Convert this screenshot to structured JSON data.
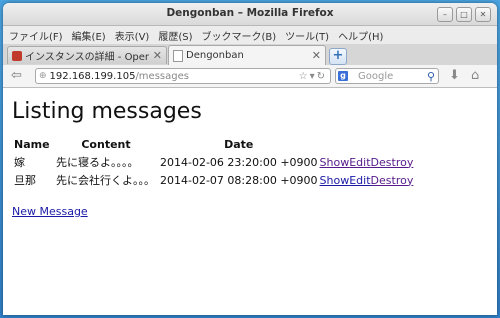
{
  "window": {
    "title": "Dengonban – Mozilla Firefox"
  },
  "menubar": {
    "items": [
      "ファイル(F)",
      "編集(E)",
      "表示(V)",
      "履歴(S)",
      "ブックマーク(B)",
      "ツール(T)",
      "ヘルプ(H)"
    ]
  },
  "tabs": [
    {
      "label": "インスタンスの詳細 - Open...",
      "icon": "red-app-icon"
    },
    {
      "label": "Dengonban",
      "icon": "page-icon"
    }
  ],
  "navbar": {
    "url_host": "192.168.199.105",
    "url_path": "/messages",
    "search_placeholder": "Google"
  },
  "page": {
    "heading": "Listing messages",
    "columns": [
      "Name",
      "Content",
      "Date"
    ],
    "rows": [
      {
        "name": "嫁",
        "content": "先に寝るよ。。。。",
        "date": "2014-02-06 23:20:00 +0900",
        "show": "Show",
        "edit": "Edit",
        "destroy": "Destroy"
      },
      {
        "name": "旦那",
        "content": "先に会社行くよ。。。",
        "date": "2014-02-07 08:28:00 +0900",
        "show": "Show",
        "edit": "Edit",
        "destroy": "Destroy"
      }
    ],
    "new_link": "New Message"
  },
  "colors": {
    "link": "#1a1aa6",
    "visited_link": "#551a8b",
    "desktop": "#3b8fd4"
  }
}
